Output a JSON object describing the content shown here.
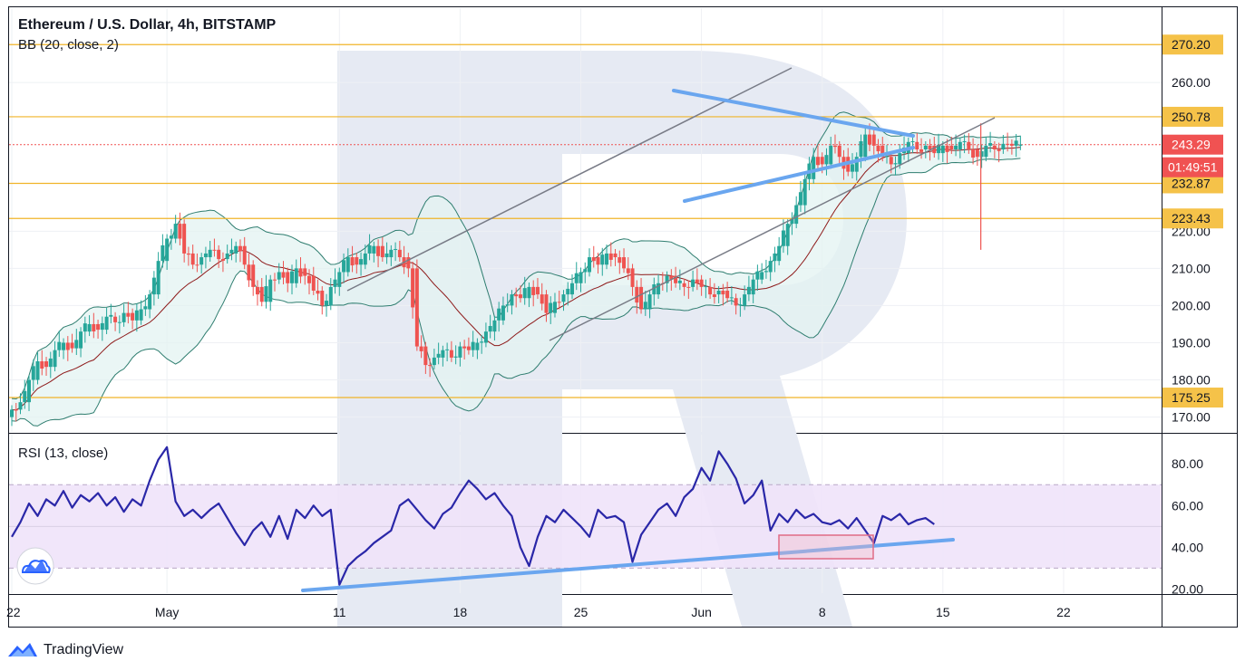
{
  "header": {
    "title": "Ethereum / U.S. Dollar, 4h, BITSTAMP",
    "bb_label": "BB (20, close, 2)",
    "rsi_label": "RSI (13, close)"
  },
  "footer": {
    "brand": "TradingView"
  },
  "colors": {
    "bull": "#26a69a",
    "bear": "#ef5350",
    "level": "#f0b429",
    "badge": "#f5c249",
    "price_badge": "#f05252",
    "trend_blue": "#6aa6ef",
    "channel": "#787b86",
    "bb_fill": "#e3f3f1",
    "bb_line": "#2e7d6f",
    "basis": "#8e1b1b",
    "rsi_line": "#2a27a8",
    "rsi_band": "#efe3fa",
    "watermark": "#e6eaf3"
  },
  "chart_data": [
    {
      "type": "candlestick",
      "title": "Ethereum / U.S. Dollar, 4h, BITSTAMP",
      "indicator": "BB (20, close, 2)",
      "x_axis": {
        "ticks": [
          "22",
          "May",
          "11",
          "18",
          "25",
          "Jun",
          "8",
          "15",
          "22"
        ],
        "tick_days": [
          0,
          9,
          19,
          26,
          33,
          40,
          47,
          54,
          61
        ],
        "range_days": [
          0,
          66
        ]
      },
      "y_axis": {
        "ticks": [
          "170.00",
          "180.00",
          "190.00",
          "200.00",
          "210.00",
          "220.00",
          "260.00"
        ],
        "range": [
          166,
          280
        ]
      },
      "horizontal_levels": [
        {
          "value": 270.2,
          "label": "270.20"
        },
        {
          "value": 250.78,
          "label": "250.78"
        },
        {
          "value": 232.87,
          "label": "232.87"
        },
        {
          "value": 223.43,
          "label": "223.43"
        },
        {
          "value": 175.25,
          "label": "175.25"
        }
      ],
      "last_price": {
        "value": 243.29,
        "label": "243.29",
        "countdown": "01:49:51"
      },
      "close_series": [
        {
          "day": 0.0,
          "close": 172.0
        },
        {
          "day": 0.5,
          "close": 174.0
        },
        {
          "day": 1.0,
          "close": 180.0
        },
        {
          "day": 1.5,
          "close": 185.0
        },
        {
          "day": 2.0,
          "close": 183.5
        },
        {
          "day": 2.5,
          "close": 188.0
        },
        {
          "day": 3.0,
          "close": 190.0
        },
        {
          "day": 3.5,
          "close": 188.5
        },
        {
          "day": 4.0,
          "close": 193.0
        },
        {
          "day": 4.5,
          "close": 195.0
        },
        {
          "day": 5.0,
          "close": 193.5
        },
        {
          "day": 5.5,
          "close": 197.0
        },
        {
          "day": 6.0,
          "close": 195.5
        },
        {
          "day": 6.5,
          "close": 198.0
        },
        {
          "day": 7.0,
          "close": 196.0
        },
        {
          "day": 7.5,
          "close": 199.0
        },
        {
          "day": 8.0,
          "close": 203.0
        },
        {
          "day": 8.5,
          "close": 212.0
        },
        {
          "day": 9.0,
          "close": 218.0
        },
        {
          "day": 9.5,
          "close": 222.0
        },
        {
          "day": 10.0,
          "close": 214.0
        },
        {
          "day": 10.5,
          "close": 211.0
        },
        {
          "day": 11.0,
          "close": 213.0
        },
        {
          "day": 11.5,
          "close": 215.0
        },
        {
          "day": 12.0,
          "close": 212.5
        },
        {
          "day": 12.5,
          "close": 214.0
        },
        {
          "day": 13.0,
          "close": 216.0
        },
        {
          "day": 13.5,
          "close": 211.0
        },
        {
          "day": 14.0,
          "close": 205.0
        },
        {
          "day": 14.5,
          "close": 201.0
        },
        {
          "day": 15.0,
          "close": 207.0
        },
        {
          "day": 15.5,
          "close": 209.0
        },
        {
          "day": 16.0,
          "close": 206.0
        },
        {
          "day": 16.5,
          "close": 210.0
        },
        {
          "day": 17.0,
          "close": 208.0
        },
        {
          "day": 17.5,
          "close": 204.0
        },
        {
          "day": 18.0,
          "close": 200.0
        },
        {
          "day": 18.5,
          "close": 205.0
        },
        {
          "day": 19.0,
          "close": 209.0
        },
        {
          "day": 19.5,
          "close": 213.0
        },
        {
          "day": 20.0,
          "close": 211.0
        },
        {
          "day": 20.5,
          "close": 214.0
        },
        {
          "day": 21.0,
          "close": 216.0
        },
        {
          "day": 21.5,
          "close": 213.0
        },
        {
          "day": 22.0,
          "close": 215.0
        },
        {
          "day": 22.5,
          "close": 213.0
        },
        {
          "day": 23.0,
          "close": 210.0
        },
        {
          "day": 23.5,
          "close": 189.0
        },
        {
          "day": 24.0,
          "close": 184.0
        },
        {
          "day": 24.5,
          "close": 186.0
        },
        {
          "day": 25.0,
          "close": 188.0
        },
        {
          "day": 25.5,
          "close": 186.0
        },
        {
          "day": 26.0,
          "close": 189.0
        },
        {
          "day": 26.5,
          "close": 188.0
        },
        {
          "day": 27.0,
          "close": 190.0
        },
        {
          "day": 27.5,
          "close": 193.0
        },
        {
          "day": 28.0,
          "close": 196.0
        },
        {
          "day": 28.5,
          "close": 200.0
        },
        {
          "day": 29.0,
          "close": 203.0
        },
        {
          "day": 29.5,
          "close": 202.0
        },
        {
          "day": 30.0,
          "close": 205.0
        },
        {
          "day": 30.5,
          "close": 203.0
        },
        {
          "day": 31.0,
          "close": 198.0
        },
        {
          "day": 31.5,
          "close": 201.0
        },
        {
          "day": 32.0,
          "close": 203.0
        },
        {
          "day": 32.5,
          "close": 206.0
        },
        {
          "day": 33.0,
          "close": 209.0
        },
        {
          "day": 33.5,
          "close": 213.0
        },
        {
          "day": 34.0,
          "close": 211.0
        },
        {
          "day": 34.5,
          "close": 214.0
        },
        {
          "day": 35.0,
          "close": 213.0
        },
        {
          "day": 35.5,
          "close": 210.0
        },
        {
          "day": 36.0,
          "close": 205.0
        },
        {
          "day": 36.5,
          "close": 199.0
        },
        {
          "day": 37.0,
          "close": 203.0
        },
        {
          "day": 37.5,
          "close": 206.0
        },
        {
          "day": 38.0,
          "close": 208.0
        },
        {
          "day": 38.5,
          "close": 206.0
        },
        {
          "day": 39.0,
          "close": 205.0
        },
        {
          "day": 39.5,
          "close": 207.0
        },
        {
          "day": 40.0,
          "close": 205.0
        },
        {
          "day": 40.5,
          "close": 203.0
        },
        {
          "day": 41.0,
          "close": 204.0
        },
        {
          "day": 41.5,
          "close": 202.0
        },
        {
          "day": 42.0,
          "close": 200.0
        },
        {
          "day": 42.5,
          "close": 203.0
        },
        {
          "day": 43.0,
          "close": 207.0
        },
        {
          "day": 43.5,
          "close": 209.0
        },
        {
          "day": 44.0,
          "close": 212.0
        },
        {
          "day": 44.5,
          "close": 216.0
        },
        {
          "day": 45.0,
          "close": 222.0
        },
        {
          "day": 45.5,
          "close": 227.0
        },
        {
          "day": 46.0,
          "close": 234.0
        },
        {
          "day": 46.5,
          "close": 240.0
        },
        {
          "day": 47.0,
          "close": 238.0
        },
        {
          "day": 47.5,
          "close": 243.0
        },
        {
          "day": 48.0,
          "close": 240.0
        },
        {
          "day": 48.5,
          "close": 236.0
        },
        {
          "day": 49.0,
          "close": 240.0
        },
        {
          "day": 49.5,
          "close": 246.0
        },
        {
          "day": 50.0,
          "close": 243.0
        },
        {
          "day": 50.5,
          "close": 240.0
        },
        {
          "day": 51.0,
          "close": 238.0
        },
        {
          "day": 51.5,
          "close": 241.0
        },
        {
          "day": 52.0,
          "close": 244.0
        },
        {
          "day": 52.5,
          "close": 242.0
        },
        {
          "day": 53.0,
          "close": 243.0
        },
        {
          "day": 53.5,
          "close": 241.0
        },
        {
          "day": 54.0,
          "close": 243.0
        },
        {
          "day": 54.5,
          "close": 242.0
        },
        {
          "day": 55.0,
          "close": 244.0
        },
        {
          "day": 55.5,
          "close": 242.0
        },
        {
          "day": 56.0,
          "close": 240.0
        },
        {
          "day": 56.5,
          "close": 243.0
        },
        {
          "day": 57.0,
          "close": 242.0
        },
        {
          "day": 57.5,
          "close": 243.5
        },
        {
          "day": 58.0,
          "close": 243.0
        },
        {
          "day": 58.5,
          "close": 243.3
        }
      ]
    },
    {
      "type": "line",
      "title": "RSI (13, close)",
      "y_axis": {
        "ticks": [
          "20.00",
          "40.00",
          "60.00",
          "80.00"
        ],
        "range": [
          18,
          94
        ],
        "band": [
          30,
          70
        ],
        "midline": 50
      },
      "series": [
        {
          "values": [
            {
              "day": 0.0,
              "value": 45
            },
            {
              "day": 0.5,
              "value": 52
            },
            {
              "day": 1.0,
              "value": 61
            },
            {
              "day": 1.5,
              "value": 55
            },
            {
              "day": 2.0,
              "value": 63
            },
            {
              "day": 2.5,
              "value": 60
            },
            {
              "day": 3.0,
              "value": 67
            },
            {
              "day": 3.5,
              "value": 59
            },
            {
              "day": 4.0,
              "value": 65
            },
            {
              "day": 4.5,
              "value": 62
            },
            {
              "day": 5.0,
              "value": 66
            },
            {
              "day": 5.5,
              "value": 60
            },
            {
              "day": 6.0,
              "value": 64
            },
            {
              "day": 6.5,
              "value": 57
            },
            {
              "day": 7.0,
              "value": 63
            },
            {
              "day": 7.5,
              "value": 60
            },
            {
              "day": 8.0,
              "value": 72
            },
            {
              "day": 8.5,
              "value": 82
            },
            {
              "day": 9.0,
              "value": 88
            },
            {
              "day": 9.5,
              "value": 62
            },
            {
              "day": 10.0,
              "value": 55
            },
            {
              "day": 10.5,
              "value": 58
            },
            {
              "day": 11.0,
              "value": 54
            },
            {
              "day": 11.5,
              "value": 58
            },
            {
              "day": 12.0,
              "value": 61
            },
            {
              "day": 12.5,
              "value": 54
            },
            {
              "day": 13.0,
              "value": 47
            },
            {
              "day": 13.5,
              "value": 41
            },
            {
              "day": 14.0,
              "value": 48
            },
            {
              "day": 14.5,
              "value": 52
            },
            {
              "day": 15.0,
              "value": 45
            },
            {
              "day": 15.5,
              "value": 55
            },
            {
              "day": 16.0,
              "value": 44
            },
            {
              "day": 16.5,
              "value": 58
            },
            {
              "day": 17.0,
              "value": 54
            },
            {
              "day": 17.5,
              "value": 60
            },
            {
              "day": 18.0,
              "value": 55
            },
            {
              "day": 18.5,
              "value": 58
            },
            {
              "day": 19.0,
              "value": 22
            },
            {
              "day": 19.5,
              "value": 31
            },
            {
              "day": 20.0,
              "value": 35
            },
            {
              "day": 20.5,
              "value": 38
            },
            {
              "day": 21.0,
              "value": 42
            },
            {
              "day": 21.5,
              "value": 45
            },
            {
              "day": 22.0,
              "value": 48
            },
            {
              "day": 22.5,
              "value": 60
            },
            {
              "day": 23.0,
              "value": 63
            },
            {
              "day": 23.5,
              "value": 58
            },
            {
              "day": 24.0,
              "value": 53
            },
            {
              "day": 24.5,
              "value": 49
            },
            {
              "day": 25.0,
              "value": 56
            },
            {
              "day": 25.5,
              "value": 59
            },
            {
              "day": 26.0,
              "value": 66
            },
            {
              "day": 26.5,
              "value": 72
            },
            {
              "day": 27.0,
              "value": 68
            },
            {
              "day": 27.5,
              "value": 63
            },
            {
              "day": 28.0,
              "value": 66
            },
            {
              "day": 28.5,
              "value": 60
            },
            {
              "day": 29.0,
              "value": 55
            },
            {
              "day": 29.5,
              "value": 40
            },
            {
              "day": 30.0,
              "value": 31
            },
            {
              "day": 30.5,
              "value": 45
            },
            {
              "day": 31.0,
              "value": 55
            },
            {
              "day": 31.5,
              "value": 52
            },
            {
              "day": 32.0,
              "value": 58
            },
            {
              "day": 32.5,
              "value": 54
            },
            {
              "day": 33.0,
              "value": 50
            },
            {
              "day": 33.5,
              "value": 45
            },
            {
              "day": 34.0,
              "value": 58
            },
            {
              "day": 34.5,
              "value": 54
            },
            {
              "day": 35.0,
              "value": 55
            },
            {
              "day": 35.5,
              "value": 52
            },
            {
              "day": 36.0,
              "value": 33
            },
            {
              "day": 36.5,
              "value": 46
            },
            {
              "day": 37.0,
              "value": 52
            },
            {
              "day": 37.5,
              "value": 58
            },
            {
              "day": 38.0,
              "value": 61
            },
            {
              "day": 38.5,
              "value": 55
            },
            {
              "day": 39.0,
              "value": 64
            },
            {
              "day": 39.5,
              "value": 68
            },
            {
              "day": 40.0,
              "value": 78
            },
            {
              "day": 40.5,
              "value": 72
            },
            {
              "day": 41.0,
              "value": 86
            },
            {
              "day": 41.5,
              "value": 80
            },
            {
              "day": 42.0,
              "value": 73
            },
            {
              "day": 42.5,
              "value": 61
            },
            {
              "day": 43.0,
              "value": 65
            },
            {
              "day": 43.5,
              "value": 72
            },
            {
              "day": 44.0,
              "value": 48
            },
            {
              "day": 44.5,
              "value": 56
            },
            {
              "day": 45.0,
              "value": 52
            },
            {
              "day": 45.5,
              "value": 58
            },
            {
              "day": 46.0,
              "value": 54
            },
            {
              "day": 46.5,
              "value": 56
            },
            {
              "day": 47.0,
              "value": 52
            },
            {
              "day": 47.5,
              "value": 51
            },
            {
              "day": 48.0,
              "value": 53
            },
            {
              "day": 48.5,
              "value": 49
            },
            {
              "day": 49.0,
              "value": 54
            },
            {
              "day": 49.5,
              "value": 48
            },
            {
              "day": 50.0,
              "value": 42
            },
            {
              "day": 50.5,
              "value": 55
            },
            {
              "day": 51.0,
              "value": 53
            },
            {
              "day": 51.5,
              "value": 56
            },
            {
              "day": 52.0,
              "value": 51
            },
            {
              "day": 52.5,
              "value": 53
            },
            {
              "day": 53.0,
              "value": 54
            },
            {
              "day": 53.5,
              "value": 51
            }
          ]
        }
      ]
    }
  ]
}
